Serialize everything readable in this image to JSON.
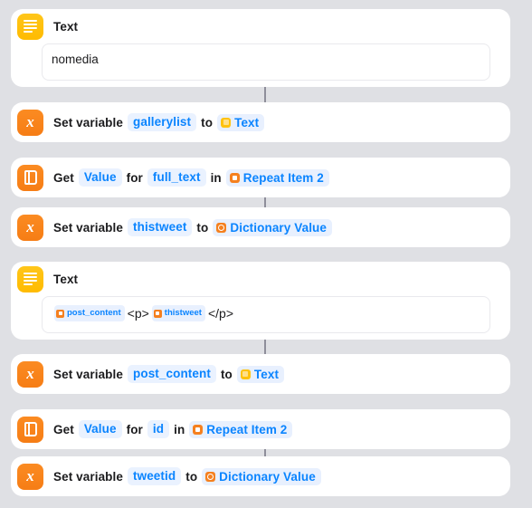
{
  "theme": {
    "background": "#dfe0e4",
    "card_background": "#ffffff",
    "accent_blue": "#0a84ff",
    "text_action_color": "#ffbb00",
    "variable_action_color": "#f67d15",
    "label_color": "#1b1b1d"
  },
  "actions": [
    {
      "id": "text-1",
      "type": "text",
      "icon": "text-lines-icon",
      "title": "Text",
      "field_value": "nomedia"
    },
    {
      "id": "setvar-1",
      "type": "set-variable",
      "icon": "x-variable-icon",
      "prefix": "Set variable",
      "variable": "gallerylist",
      "connector": "to",
      "magic_variable": {
        "label": "Text",
        "icon": "text-chip-icon"
      }
    },
    {
      "id": "getvalue-1",
      "type": "get-dictionary-value",
      "icon": "dictionary-book-icon",
      "prefix": "Get",
      "value_type": "Value",
      "for_label": "for",
      "key": "full_text",
      "in_label": "in",
      "magic_variable": {
        "label": "Repeat Item 2",
        "icon": "repeat-item-chip-icon"
      }
    },
    {
      "id": "setvar-2",
      "type": "set-variable",
      "icon": "x-variable-icon",
      "prefix": "Set variable",
      "variable": "thistweet",
      "connector": "to",
      "magic_variable": {
        "label": "Dictionary Value",
        "icon": "dictionary-value-chip-icon"
      }
    },
    {
      "id": "text-2",
      "type": "text",
      "icon": "text-lines-icon",
      "title": "Text",
      "field_tokens": [
        {
          "kind": "token",
          "label": "post_content",
          "icon": "variable-chip-icon"
        },
        {
          "kind": "text",
          "label": "<p>"
        },
        {
          "kind": "token",
          "label": "thistweet",
          "icon": "variable-chip-icon"
        },
        {
          "kind": "text",
          "label": "</p>"
        }
      ]
    },
    {
      "id": "setvar-3",
      "type": "set-variable",
      "icon": "x-variable-icon",
      "prefix": "Set variable",
      "variable": "post_content",
      "connector": "to",
      "magic_variable": {
        "label": "Text",
        "icon": "text-chip-icon"
      }
    },
    {
      "id": "getvalue-2",
      "type": "get-dictionary-value",
      "icon": "dictionary-book-icon",
      "prefix": "Get",
      "value_type": "Value",
      "for_label": "for",
      "key": "id",
      "in_label": "in",
      "magic_variable": {
        "label": "Repeat Item 2",
        "icon": "repeat-item-chip-icon"
      }
    },
    {
      "id": "setvar-4",
      "type": "set-variable",
      "icon": "x-variable-icon",
      "prefix": "Set variable",
      "variable": "tweetid",
      "connector": "to",
      "magic_variable": {
        "label": "Dictionary Value",
        "icon": "dictionary-value-chip-icon"
      }
    }
  ]
}
